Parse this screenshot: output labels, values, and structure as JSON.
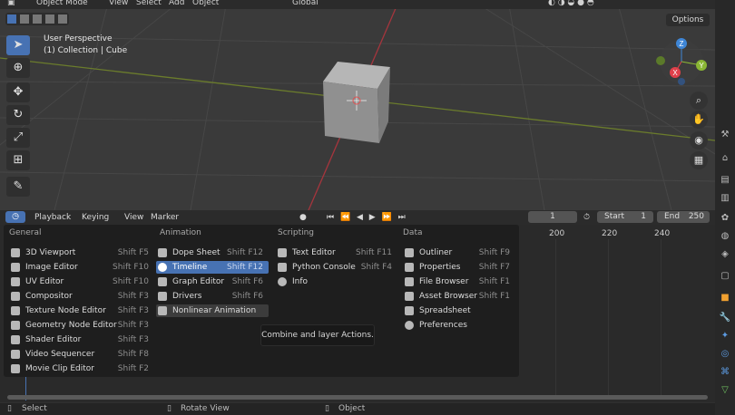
{
  "header": {
    "mode": "Object Mode",
    "menus": [
      "View",
      "Select",
      "Add",
      "Object"
    ],
    "orientation": "Global",
    "options": "Options"
  },
  "viewport": {
    "perspective": "User Perspective",
    "collection": "(1) Collection | Cube",
    "gizmo": {
      "x": "X",
      "y": "Y",
      "z": "Z"
    }
  },
  "timeline": {
    "editor_icon": "clock-icon",
    "menus": {
      "playback": "Playback",
      "keying": "Keying",
      "view": "View",
      "marker": "Marker"
    },
    "current_frame": "1",
    "start_label": "Start",
    "start_value": "1",
    "end_label": "End",
    "end_value": "250",
    "ticks": [
      "200",
      "220",
      "240"
    ]
  },
  "menu": {
    "columns": [
      {
        "title": "General",
        "items": [
          {
            "label": "3D Viewport",
            "shortcut": "Shift F5"
          },
          {
            "label": "Image Editor",
            "shortcut": "Shift F10"
          },
          {
            "label": "UV Editor",
            "shortcut": "Shift F10"
          },
          {
            "label": "Compositor",
            "shortcut": "Shift F3"
          },
          {
            "label": "Texture Node Editor",
            "shortcut": "Shift F3"
          },
          {
            "label": "Geometry Node Editor",
            "shortcut": "Shift F3"
          },
          {
            "label": "Shader Editor",
            "shortcut": "Shift F3"
          },
          {
            "label": "Video Sequencer",
            "shortcut": "Shift F8"
          },
          {
            "label": "Movie Clip Editor",
            "shortcut": "Shift F2"
          }
        ]
      },
      {
        "title": "Animation",
        "items": [
          {
            "label": "Dope Sheet",
            "shortcut": "Shift F12"
          },
          {
            "label": "Timeline",
            "shortcut": "Shift F12"
          },
          {
            "label": "Graph Editor",
            "shortcut": "Shift F6"
          },
          {
            "label": "Drivers",
            "shortcut": "Shift F6"
          },
          {
            "label": "Nonlinear Animation",
            "shortcut": ""
          }
        ]
      },
      {
        "title": "Scripting",
        "items": [
          {
            "label": "Text Editor",
            "shortcut": "Shift F11"
          },
          {
            "label": "Python Console",
            "shortcut": "Shift F4"
          },
          {
            "label": "Info",
            "shortcut": ""
          }
        ]
      },
      {
        "title": "Data",
        "items": [
          {
            "label": "Outliner",
            "shortcut": "Shift F9"
          },
          {
            "label": "Properties",
            "shortcut": "Shift F7"
          },
          {
            "label": "File Browser",
            "shortcut": "Shift F1"
          },
          {
            "label": "Asset Browser",
            "shortcut": "Shift F1"
          },
          {
            "label": "Spreadsheet",
            "shortcut": ""
          },
          {
            "label": "Preferences",
            "shortcut": ""
          }
        ]
      }
    ],
    "tooltip": "Combine and layer Actions."
  },
  "status": {
    "select": "Select",
    "rotate": "Rotate View",
    "object": "Object"
  },
  "colors": {
    "accent": "#4772b3",
    "x_axis": "#e0404a",
    "y_axis": "#8ab634",
    "z_axis": "#3f86d6"
  }
}
